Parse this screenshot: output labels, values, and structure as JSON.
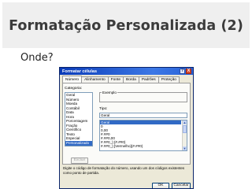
{
  "slide": {
    "title": "Formatação Personalizada (2)",
    "subtitle": "Onde?"
  },
  "dialog": {
    "title": "Formatar células",
    "titlebar_buttons": [
      "?",
      "X"
    ],
    "tabs": [
      {
        "label": "Número",
        "active": true
      },
      {
        "label": "Alinhamento",
        "active": false
      },
      {
        "label": "Fonte",
        "active": false
      },
      {
        "label": "Borda",
        "active": false
      },
      {
        "label": "Padrões",
        "active": false
      },
      {
        "label": "Proteção",
        "active": false
      }
    ],
    "category_label": "Categoria:",
    "categories": [
      "Geral",
      "Número",
      "Moeda",
      "Contábil",
      "Data",
      "Hora",
      "Porcentagem",
      "Fração",
      "Científico",
      "Texto",
      "Especial",
      "Personalizado"
    ],
    "selected_category": "Personalizado",
    "sample_label": "Exemplo",
    "type_label": "Tipo:",
    "type_value": "Geral",
    "formats": [
      "Geral",
      "0",
      "0,00",
      "#.##0",
      "#.##0,00",
      "#.##0_);(#.##0)",
      "#.##0_);[Vermelho](#.##0)"
    ],
    "selected_format": "Geral",
    "delete_label": "Excluir",
    "description": "Digite o código de formatação do número, usando um dos códigos existentes como ponto de partida.",
    "ok_label": "OK",
    "cancel_label": "Cancelar"
  },
  "colors": {
    "titlebar": "#0a3bb8",
    "selection": "#316ac5",
    "dialog_bg": "#ece9d8",
    "title_band": "#efefef"
  }
}
